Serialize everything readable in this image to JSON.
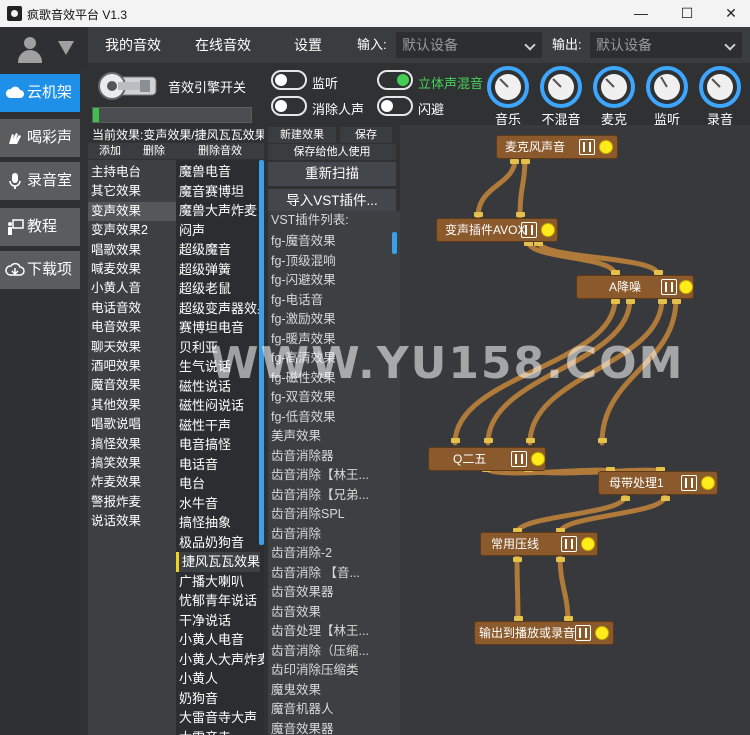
{
  "window": {
    "title": "疯歌音效平台 V1.3",
    "minimize": "—",
    "maximize": "☐",
    "close": "✕"
  },
  "nav": {
    "tabs": [
      "我的音效",
      "在线音效",
      "设置"
    ],
    "input_label": "输入:",
    "input_value": "默认设备",
    "output_label": "输出:",
    "output_value": "默认设备"
  },
  "sidebar": {
    "items": [
      {
        "label": "云机架",
        "icon": "cloud-icon",
        "active": true
      },
      {
        "label": "喝彩声",
        "icon": "clap-icon"
      },
      {
        "label": "录音室",
        "icon": "microphone-icon"
      },
      {
        "label": "教程",
        "icon": "teacher-icon"
      },
      {
        "label": "下载项",
        "icon": "cloud-download-icon"
      }
    ]
  },
  "controls": {
    "engine_label": "音效引擎开关",
    "progress": 0.04,
    "toggles": [
      {
        "label": "监听",
        "on": false
      },
      {
        "label": "消除人声",
        "on": false
      },
      {
        "label": "立体声混音",
        "on": true
      },
      {
        "label": "闪避",
        "on": false
      }
    ],
    "knobs": [
      "音乐",
      "不混音",
      "麦克",
      "监听",
      "录音"
    ]
  },
  "lists": {
    "current_effect": "当前效果:变声效果/捷风瓦瓦效果",
    "btn_add": "添加",
    "btn_delete": "删除",
    "btn_delete_effect": "删除音效",
    "categories": [
      "主持电台",
      "其它效果",
      "变声效果",
      "变声效果2",
      "唱歌效果",
      "喊麦效果",
      "小黄人音",
      "电话音效",
      "电音效果",
      "聊天效果",
      "酒吧效果",
      "魔音效果",
      "其他效果",
      "唱歌说唱",
      "搞怪效果",
      "搞笑效果",
      "炸麦效果",
      "警报炸麦",
      "说话效果"
    ],
    "selected_category": 2,
    "effects": [
      "魔兽电音",
      "魔音赛博坦",
      "魔兽大声炸麦",
      "闷声",
      "超级魔音",
      "超级弹簧",
      "超级老鼠",
      "超级变声器效果",
      "赛博坦电音",
      "贝利亚",
      "生气说话",
      "磁性说话",
      "磁性闷说话",
      "磁性干声",
      "电音搞怪",
      "电话音",
      "电台",
      "水牛音",
      "搞怪抽象",
      "极品奶狗音",
      "捷风瓦瓦效果",
      "广播大喇叭",
      "忧郁青年说话",
      "干净说话",
      "小黄人电音",
      "小黄人大声炸麦",
      "小黄人",
      "奶狗音",
      "大雷音寺大声",
      "大雷音寺"
    ],
    "selected_effect": 20
  },
  "vst": {
    "btn_new": "新建效果",
    "btn_save": "保存",
    "btn_save_share": "保存给他人使用",
    "btn_rescan": "重新扫描",
    "btn_import": "导入VST插件...",
    "list_title": "VST插件列表:",
    "plugins": [
      "fg-魔音效果",
      "fg-顶级混响",
      "fg-闪避效果",
      "fg-电话音",
      "fg-激励效果",
      "fg-暖声效果",
      "fg-高清效果",
      "fg-磁性效果",
      "fg-双音效果",
      "fg-低音效果",
      "美声效果",
      "齿音消除器",
      "齿音消除【林王...",
      "齿音消除【兄弟...",
      "齿音消除SPL",
      "齿音消除",
      "齿音消除-2",
      "齿音消除    【音...",
      "齿音效果器",
      "齿音效果",
      "齿音处理【林王...",
      "齿音消除（压缩...",
      "齿印消除压缩类",
      "魔鬼效果",
      "魔音机器人",
      "魔音效果器"
    ]
  },
  "graph": {
    "nodes": [
      {
        "id": "mic",
        "label": "麦克风声音"
      },
      {
        "id": "avox",
        "label": "变声插件AVOX"
      },
      {
        "id": "nr",
        "label": "A降噪"
      },
      {
        "id": "q25",
        "label": "Q二五"
      },
      {
        "id": "band",
        "label": "母带处理1"
      },
      {
        "id": "comp",
        "label": "常用压线"
      },
      {
        "id": "out",
        "label": "输出到播放或录音"
      }
    ]
  },
  "watermark": "WWW.YU158.COM"
}
